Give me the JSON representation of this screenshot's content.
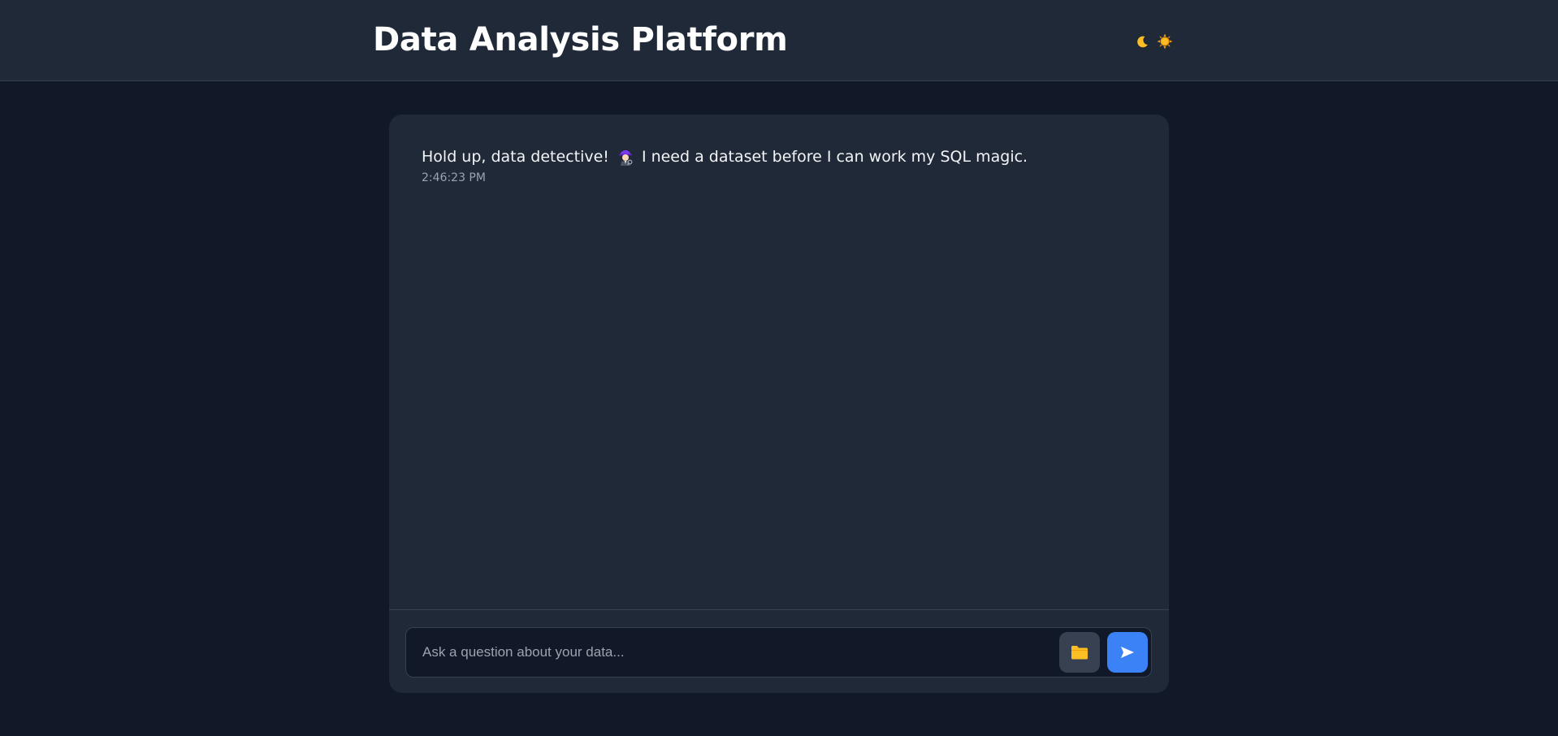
{
  "header": {
    "title": "Data Analysis Platform",
    "theme_toggle": {
      "icons": [
        "moon-icon",
        "sun-icon"
      ],
      "moon_color": "#fbbf24",
      "sun_color": "#f59e0b"
    }
  },
  "chat": {
    "messages": [
      {
        "text_before": "Hold up, data detective!",
        "emoji": "detective-icon",
        "text_after": "I need a dataset before I can work my SQL magic.",
        "time": "2:46:23 PM"
      }
    ]
  },
  "composer": {
    "placeholder": "Ask a question about your data...",
    "value": "",
    "upload_icon": "folder-icon",
    "send_icon": "send-icon"
  },
  "colors": {
    "background": "#111827",
    "surface": "#1f2937",
    "border": "#374151",
    "accent": "#3b82f6",
    "folder": "#fbbf24"
  }
}
